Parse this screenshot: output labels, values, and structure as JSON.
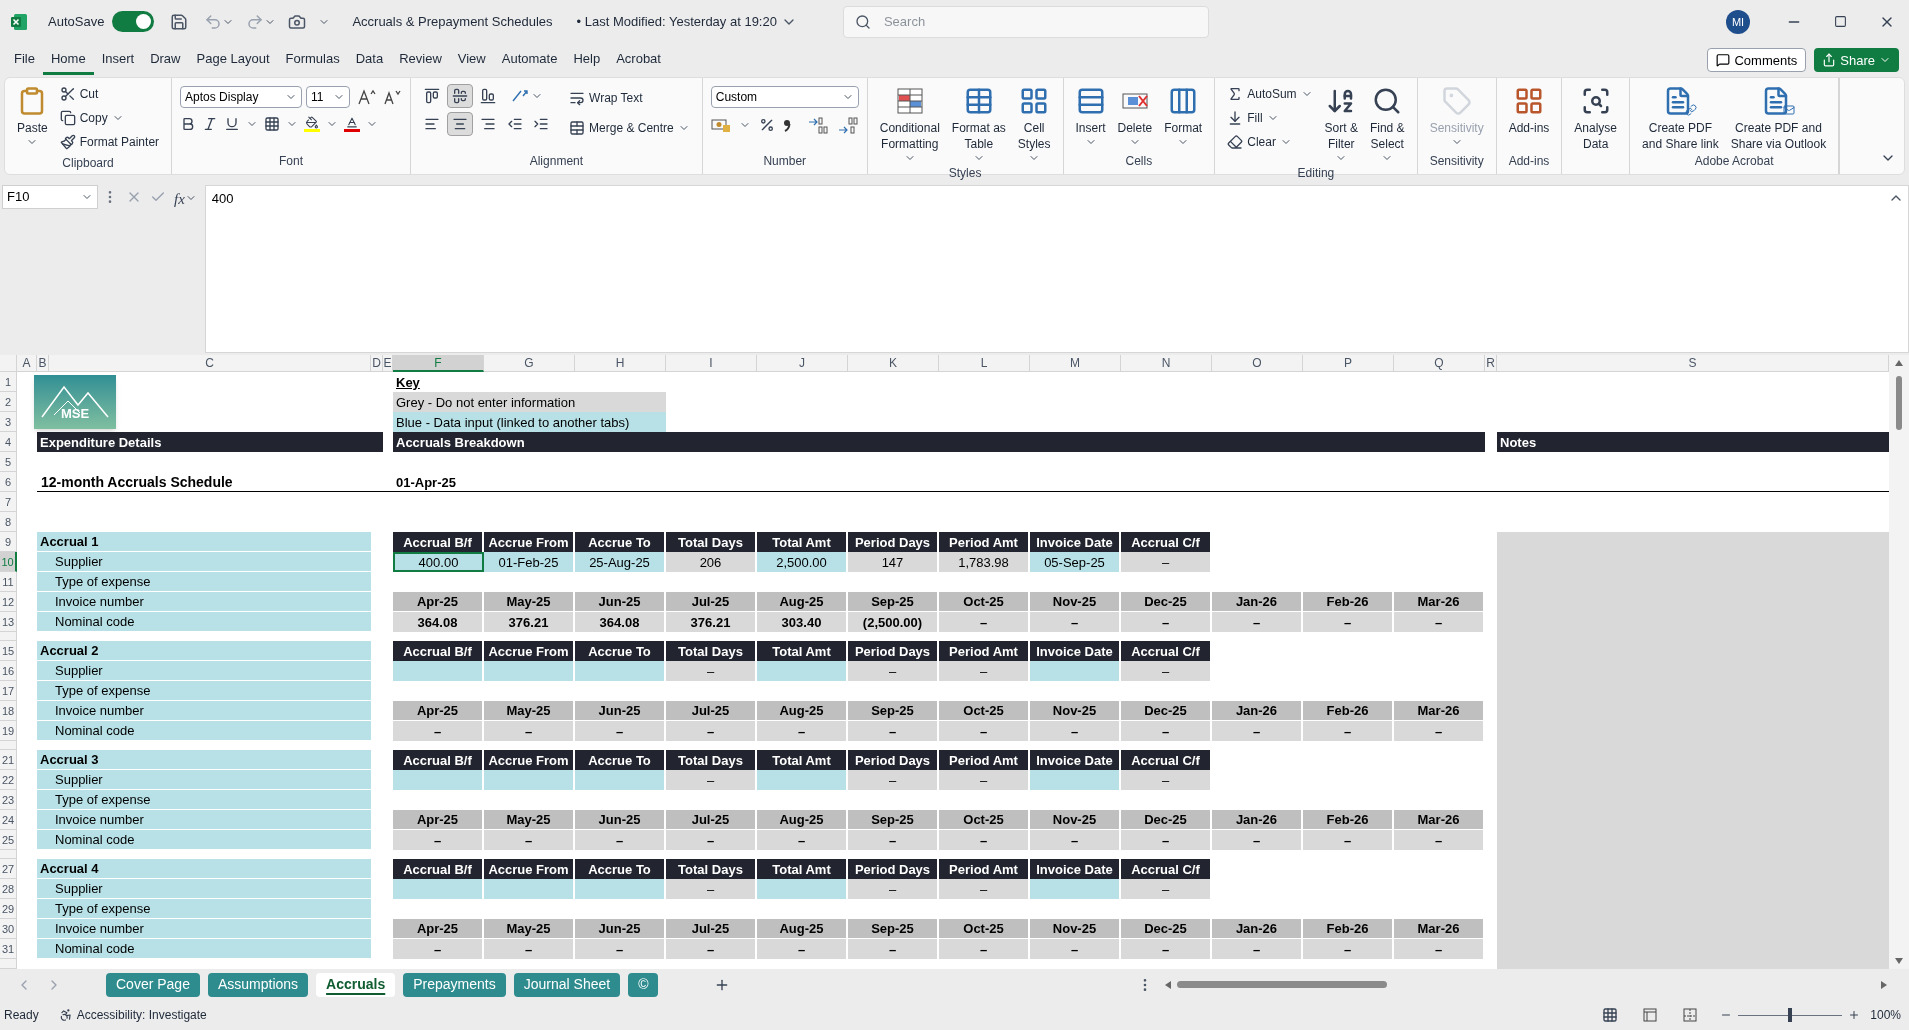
{
  "title_bar": {
    "autosave_label": "AutoSave",
    "autosave_on": true,
    "document_title": "Accruals & Prepayment Schedules",
    "last_modified": "• Last Modified: Yesterday at 19:20",
    "search_placeholder": "Search",
    "avatar_initials": "MI"
  },
  "menu_tabs": [
    {
      "label": "File",
      "selected": false
    },
    {
      "label": "Home",
      "selected": true
    },
    {
      "label": "Insert",
      "selected": false
    },
    {
      "label": "Draw",
      "selected": false
    },
    {
      "label": "Page Layout",
      "selected": false
    },
    {
      "label": "Formulas",
      "selected": false
    },
    {
      "label": "Data",
      "selected": false
    },
    {
      "label": "Review",
      "selected": false
    },
    {
      "label": "View",
      "selected": false
    },
    {
      "label": "Automate",
      "selected": false
    },
    {
      "label": "Help",
      "selected": false
    },
    {
      "label": "Acrobat",
      "selected": false
    }
  ],
  "share_buttons": {
    "comments": "Comments",
    "share": "Share"
  },
  "ribbon": {
    "clipboard": {
      "label": "Clipboard",
      "paste": "Paste",
      "cut": "Cut",
      "copy": "Copy",
      "format_painter": "Format Painter"
    },
    "font": {
      "label": "Font",
      "font_name": "Aptos Display",
      "font_size": "11"
    },
    "alignment": {
      "label": "Alignment",
      "vertical": [
        {
          "selected": false
        },
        {
          "selected": true
        },
        {
          "selected": false
        }
      ],
      "horizontal": [
        {
          "selected": false
        },
        {
          "selected": true
        },
        {
          "selected": false
        }
      ],
      "wrap_text": "Wrap Text",
      "merge": "Merge & Centre"
    },
    "number": {
      "label": "Number",
      "format": "Custom"
    },
    "styles": {
      "label": "Styles",
      "buttons": [
        [
          "Conditional",
          "Formatting"
        ],
        [
          "Format as",
          "Table"
        ],
        [
          "Cell",
          "Styles"
        ]
      ]
    },
    "cells": {
      "label": "Cells",
      "buttons": [
        "Insert",
        "Delete",
        "Format"
      ]
    },
    "editing": {
      "label": "Editing",
      "autosum": "AutoSum",
      "fill": "Fill",
      "clear": "Clear",
      "buttons": [
        [
          "Sort &",
          "Filter"
        ],
        [
          "Find &",
          "Select"
        ]
      ]
    },
    "sensitivity": {
      "label": "Sensitivity",
      "button": "Sensitivity",
      "disabled": true
    },
    "addins": {
      "label": "Add-ins",
      "button": "Add-ins"
    },
    "analyse": {
      "button": [
        "Analyse",
        "Data"
      ]
    },
    "acrobat": {
      "label": "Adobe Acrobat",
      "buttons": [
        [
          "Create PDF",
          "and Share link"
        ],
        [
          "Create PDF and",
          "Share via Outlook"
        ]
      ]
    }
  },
  "formula_bar": {
    "name_box": "F10",
    "function_label": "fx",
    "value": "400"
  },
  "columns": [
    {
      "label": "A",
      "selected": false
    },
    {
      "label": "B",
      "selected": false
    },
    {
      "label": "C",
      "selected": false
    },
    {
      "label": "D",
      "selected": false
    },
    {
      "label": "E",
      "selected": false
    },
    {
      "label": "F",
      "selected": true
    },
    {
      "label": "G",
      "selected": false
    },
    {
      "label": "H",
      "selected": false
    },
    {
      "label": "I",
      "selected": false
    },
    {
      "label": "J",
      "selected": false
    },
    {
      "label": "K",
      "selected": false
    },
    {
      "label": "L",
      "selected": false
    },
    {
      "label": "M",
      "selected": false
    },
    {
      "label": "N",
      "selected": false
    },
    {
      "label": "O",
      "selected": false
    },
    {
      "label": "P",
      "selected": false
    },
    {
      "label": "Q",
      "selected": false
    },
    {
      "label": "R",
      "selected": false
    },
    {
      "label": "S",
      "selected": false
    }
  ],
  "rows": [
    {
      "label": "1",
      "kind": "normal",
      "selected": false
    },
    {
      "label": "2",
      "kind": "normal",
      "selected": false
    },
    {
      "label": "3",
      "kind": "normal",
      "selected": false
    },
    {
      "label": "4",
      "kind": "normal",
      "selected": false
    },
    {
      "label": "5",
      "kind": "normal",
      "selected": false
    },
    {
      "label": "6",
      "kind": "normal",
      "selected": false
    },
    {
      "label": "7",
      "kind": "normal",
      "selected": false
    },
    {
      "label": "8",
      "kind": "normal",
      "selected": false
    },
    {
      "label": "9",
      "kind": "normal",
      "selected": false
    },
    {
      "label": "10",
      "kind": "normal",
      "selected": true
    },
    {
      "label": "11",
      "kind": "normal",
      "selected": false
    },
    {
      "label": "12",
      "kind": "normal",
      "selected": false
    },
    {
      "label": "13",
      "kind": "normal",
      "selected": false
    },
    {
      "kind": "short",
      "selected": false
    },
    {
      "label": "15",
      "kind": "normal",
      "selected": false
    },
    {
      "label": "16",
      "kind": "normal",
      "selected": false
    },
    {
      "label": "17",
      "kind": "normal",
      "selected": false
    },
    {
      "label": "18",
      "kind": "normal",
      "selected": false
    },
    {
      "label": "19",
      "kind": "normal",
      "selected": false
    },
    {
      "kind": "short",
      "selected": false
    },
    {
      "label": "21",
      "kind": "normal",
      "selected": false
    },
    {
      "label": "22",
      "kind": "normal",
      "selected": false
    },
    {
      "label": "23",
      "kind": "normal",
      "selected": false
    },
    {
      "label": "24",
      "kind": "normal",
      "selected": false
    },
    {
      "label": "25",
      "kind": "normal",
      "selected": false
    },
    {
      "kind": "short",
      "selected": false
    },
    {
      "label": "27",
      "kind": "normal",
      "selected": false
    },
    {
      "label": "28",
      "kind": "normal",
      "selected": false
    },
    {
      "label": "29",
      "kind": "normal",
      "selected": false
    },
    {
      "label": "30",
      "kind": "normal",
      "selected": false
    },
    {
      "label": "31",
      "kind": "normal",
      "selected": false
    },
    {
      "kind": "end",
      "selected": false
    }
  ],
  "sheet": {
    "logo_text": "MSE",
    "key": {
      "title": "Key",
      "items": [
        {
          "text": "Grey - Do not enter information",
          "kind": "calc"
        },
        {
          "text": "Blue - Data input (linked to another tabs)",
          "kind": "input"
        }
      ]
    },
    "section_bars": [
      "Expenditure Details",
      "Accruals Breakdown",
      "Notes"
    ],
    "schedule_title": "12-month Accruals Schedule",
    "start_date": "01-Apr-25",
    "accruals": [
      {
        "title": "Accrual 1",
        "fields": [
          "Supplier",
          "Type of expense",
          "Invoice number",
          "Nominal code"
        ],
        "headers": [
          "Accrual B/f",
          "Accrue From",
          "Accrue To",
          "Total Days",
          "Total Amt",
          "Period Days",
          "Period Amt",
          "Invoice Date",
          "Accrual C/f"
        ],
        "values": [
          {
            "text": "400.00",
            "kind": "input",
            "selected": true
          },
          {
            "text": "01-Feb-25",
            "kind": "input",
            "selected": false
          },
          {
            "text": "25-Aug-25",
            "kind": "input",
            "selected": false
          },
          {
            "text": "206",
            "kind": "calc",
            "selected": false
          },
          {
            "text": "2,500.00",
            "kind": "input",
            "selected": false
          },
          {
            "text": "147",
            "kind": "calc",
            "selected": false
          },
          {
            "text": "1,783.98",
            "kind": "calc",
            "selected": false
          },
          {
            "text": "05-Sep-25",
            "kind": "input",
            "selected": false
          },
          {
            "text": "–",
            "kind": "calc",
            "selected": false
          }
        ],
        "months": [
          "Apr-25",
          "May-25",
          "Jun-25",
          "Jul-25",
          "Aug-25",
          "Sep-25",
          "Oct-25",
          "Nov-25",
          "Dec-25",
          "Jan-26",
          "Feb-26",
          "Mar-26"
        ],
        "amounts": [
          "364.08",
          "376.21",
          "364.08",
          "376.21",
          "303.40",
          "(2,500.00)",
          "–",
          "–",
          "–",
          "–",
          "–",
          "–"
        ]
      },
      {
        "title": "Accrual 2",
        "fields": [
          "Supplier",
          "Type of expense",
          "Invoice number",
          "Nominal code"
        ],
        "headers": [
          "Accrual B/f",
          "Accrue From",
          "Accrue To",
          "Total Days",
          "Total Amt",
          "Period Days",
          "Period Amt",
          "Invoice Date",
          "Accrual C/f"
        ],
        "values": [
          {
            "kind": "input",
            "selected": false
          },
          {
            "kind": "input",
            "selected": false
          },
          {
            "kind": "input",
            "selected": false
          },
          {
            "text": "–",
            "kind": "calc",
            "selected": false
          },
          {
            "kind": "input",
            "selected": false
          },
          {
            "text": "–",
            "kind": "calc",
            "selected": false
          },
          {
            "text": "–",
            "kind": "calc",
            "selected": false
          },
          {
            "kind": "input",
            "selected": false
          },
          {
            "text": "–",
            "kind": "calc",
            "selected": false
          }
        ],
        "months": [
          "Apr-25",
          "May-25",
          "Jun-25",
          "Jul-25",
          "Aug-25",
          "Sep-25",
          "Oct-25",
          "Nov-25",
          "Dec-25",
          "Jan-26",
          "Feb-26",
          "Mar-26"
        ],
        "amounts": [
          "–",
          "–",
          "–",
          "–",
          "–",
          "–",
          "–",
          "–",
          "–",
          "–",
          "–",
          "–"
        ]
      },
      {
        "title": "Accrual 3",
        "fields": [
          "Supplier",
          "Type of expense",
          "Invoice number",
          "Nominal code"
        ],
        "headers": [
          "Accrual B/f",
          "Accrue From",
          "Accrue To",
          "Total Days",
          "Total Amt",
          "Period Days",
          "Period Amt",
          "Invoice Date",
          "Accrual C/f"
        ],
        "values": [
          {
            "kind": "input",
            "selected": false
          },
          {
            "kind": "input",
            "selected": false
          },
          {
            "kind": "input",
            "selected": false
          },
          {
            "text": "–",
            "kind": "calc",
            "selected": false
          },
          {
            "kind": "input",
            "selected": false
          },
          {
            "text": "–",
            "kind": "calc",
            "selected": false
          },
          {
            "text": "–",
            "kind": "calc",
            "selected": false
          },
          {
            "kind": "input",
            "selected": false
          },
          {
            "text": "–",
            "kind": "calc",
            "selected": false
          }
        ],
        "months": [
          "Apr-25",
          "May-25",
          "Jun-25",
          "Jul-25",
          "Aug-25",
          "Sep-25",
          "Oct-25",
          "Nov-25",
          "Dec-25",
          "Jan-26",
          "Feb-26",
          "Mar-26"
        ],
        "amounts": [
          "–",
          "–",
          "–",
          "–",
          "–",
          "–",
          "–",
          "–",
          "–",
          "–",
          "–",
          "–"
        ]
      },
      {
        "title": "Accrual 4",
        "fields": [
          "Supplier",
          "Type of expense",
          "Invoice number",
          "Nominal code"
        ],
        "headers": [
          "Accrual B/f",
          "Accrue From",
          "Accrue To",
          "Total Days",
          "Total Amt",
          "Period Days",
          "Period Amt",
          "Invoice Date",
          "Accrual C/f"
        ],
        "values": [
          {
            "kind": "input",
            "selected": false
          },
          {
            "kind": "input",
            "selected": false
          },
          {
            "kind": "input",
            "selected": false
          },
          {
            "text": "–",
            "kind": "calc",
            "selected": false
          },
          {
            "kind": "input",
            "selected": false
          },
          {
            "text": "–",
            "kind": "calc",
            "selected": false
          },
          {
            "text": "–",
            "kind": "calc",
            "selected": false
          },
          {
            "kind": "input",
            "selected": false
          },
          {
            "text": "–",
            "kind": "calc",
            "selected": false
          }
        ],
        "months": [
          "Apr-25",
          "May-25",
          "Jun-25",
          "Jul-25",
          "Aug-25",
          "Sep-25",
          "Oct-25",
          "Nov-25",
          "Dec-25",
          "Jan-26",
          "Feb-26",
          "Mar-26"
        ],
        "amounts": [
          "–",
          "–",
          "–",
          "–",
          "–",
          "–",
          "–",
          "–",
          "–",
          "–",
          "–",
          "–"
        ]
      }
    ]
  },
  "sheet_tabs": [
    {
      "label": "Cover Page",
      "selected": false
    },
    {
      "label": "Assumptions",
      "selected": false
    },
    {
      "label": "Accruals",
      "selected": true
    },
    {
      "label": "Prepayments",
      "selected": false
    },
    {
      "label": "Journal Sheet",
      "selected": false
    },
    {
      "label": "©",
      "selected": false
    }
  ],
  "status_bar": {
    "status": "Ready",
    "accessibility": "Accessibility: Investigate",
    "zoom": {
      "label": "100%",
      "level": 0.5
    }
  }
}
